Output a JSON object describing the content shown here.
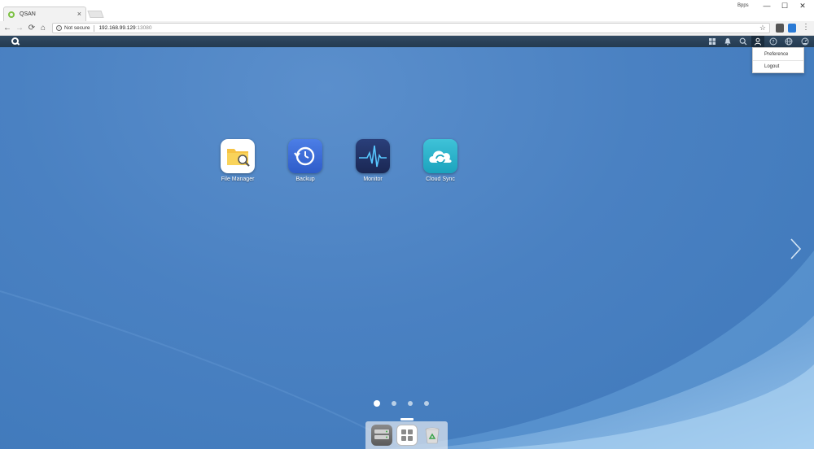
{
  "browser": {
    "tab_title": "QSAN",
    "tab_close": "×",
    "window_user": "Bpps",
    "window_controls": {
      "minimize": "—",
      "maximize": "☐",
      "close": "✕"
    },
    "nav": {
      "back": "←",
      "forward": "→",
      "reload": "⟳",
      "home": "⌂"
    },
    "security_label": "Not secure",
    "url_host": "192.168.99.129",
    "url_port": ":13080",
    "star": "☆",
    "menu": "⋮"
  },
  "appbar": {
    "icons": [
      "grid-icon",
      "bell-icon",
      "search-icon",
      "user-icon",
      "help-icon",
      "globe-icon",
      "dashboard-icon"
    ]
  },
  "user_menu": {
    "items": [
      "Preference",
      "Logout"
    ]
  },
  "desktop": {
    "apps": [
      {
        "label": "File Manager",
        "icon": "file-manager-icon"
      },
      {
        "label": "Backup",
        "icon": "backup-icon"
      },
      {
        "label": "Monitor",
        "icon": "monitor-icon"
      },
      {
        "label": "Cloud Sync",
        "icon": "cloud-sync-icon"
      }
    ],
    "page_count": 4,
    "active_page": 1
  },
  "dock": {
    "items": [
      "storage-icon",
      "app-grid-icon",
      "recycle-bin-icon"
    ]
  },
  "colors": {
    "appbar": "#2a4259",
    "desktop": "#4a81c2",
    "tab_favicon": "#7bc142"
  }
}
